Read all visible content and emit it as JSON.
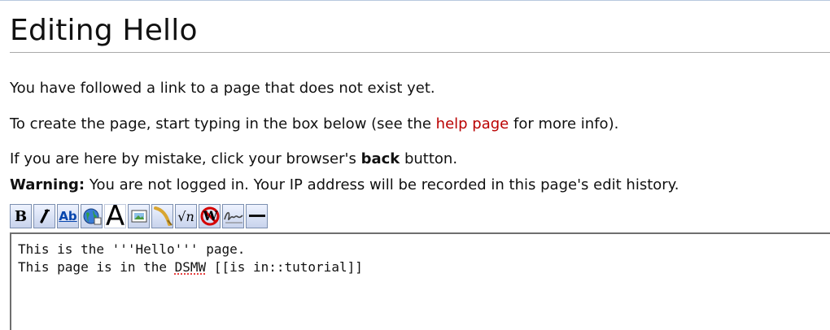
{
  "page": {
    "title": "Editing Hello"
  },
  "notices": {
    "not_exist": "You have followed a link to a page that does not exist yet.",
    "create_prefix": "To create the page, start typing in the box below (see the ",
    "help_link": "help page",
    "create_suffix": " for more info).",
    "mistake_prefix": "If you are here by mistake, click your browser's ",
    "mistake_bold": "back",
    "mistake_suffix": " button.",
    "warning_label": "Warning:",
    "warning_text": " You are not logged in. Your IP address will be recorded in this page's edit history."
  },
  "toolbar": {
    "buttons": [
      {
        "name": "bold-button",
        "label": "B",
        "icon": "bold-icon"
      },
      {
        "name": "italic-button",
        "label": "I",
        "icon": "italic-icon"
      },
      {
        "name": "internal-link-button",
        "label": "Ab",
        "icon": "internal-link-icon"
      },
      {
        "name": "external-link-button",
        "icon": "globe-link-icon"
      },
      {
        "name": "headline-button",
        "label": "A",
        "icon": "headline-icon"
      },
      {
        "name": "embedded-file-button",
        "icon": "image-icon"
      },
      {
        "name": "media-link-button",
        "icon": "media-icon"
      },
      {
        "name": "math-formula-button",
        "label": "√n",
        "icon": "math-icon"
      },
      {
        "name": "nowiki-button",
        "label": "W",
        "icon": "nowiki-icon"
      },
      {
        "name": "signature-button",
        "icon": "signature-icon"
      },
      {
        "name": "horizontal-line-button",
        "icon": "horizontal-line-icon"
      }
    ]
  },
  "editor": {
    "line1": "This is the '''Hello''' page.",
    "line2_prefix": "This page is in the ",
    "line2_word": "DSMW",
    "line2_suffix": " [[is in::tutorial]]"
  },
  "colors": {
    "link_red": "#ba0000",
    "toolbar_border": "#7c8fb0",
    "link_blue": "#0645ad"
  }
}
